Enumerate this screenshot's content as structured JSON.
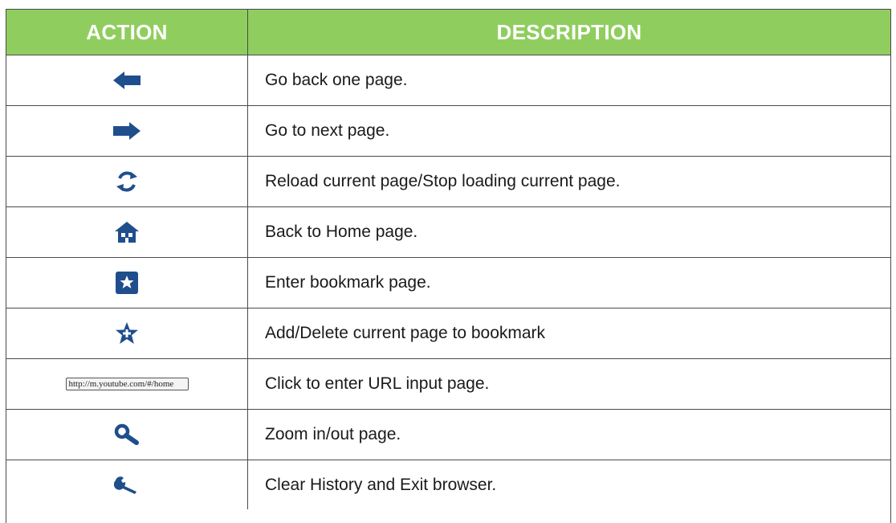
{
  "header": {
    "action": "ACTION",
    "description": "DESCRIPTION"
  },
  "rows": [
    {
      "icon": "back-arrow-icon",
      "description": "Go back one page."
    },
    {
      "icon": "forward-arrow-icon",
      "description": "Go to next page."
    },
    {
      "icon": "reload-icon",
      "description": "Reload current page/Stop loading current page."
    },
    {
      "icon": "home-icon",
      "description": "Back to Home page."
    },
    {
      "icon": "bookmark-page-icon",
      "description": "Enter bookmark page."
    },
    {
      "icon": "add-bookmark-icon",
      "description": "Add/Delete current page to bookmark"
    },
    {
      "icon": "url-input-box",
      "url_text": "http://m.youtube.com/#/home",
      "description": "Click to enter URL input page."
    },
    {
      "icon": "zoom-icon",
      "description": "Zoom in/out page."
    },
    {
      "icon": "wrench-icon",
      "description": "Clear History and Exit browser."
    }
  ],
  "colors": {
    "header_bg": "#8fce5e",
    "icon_blue": "#1f4e8c",
    "border": "#4a4a4a"
  }
}
